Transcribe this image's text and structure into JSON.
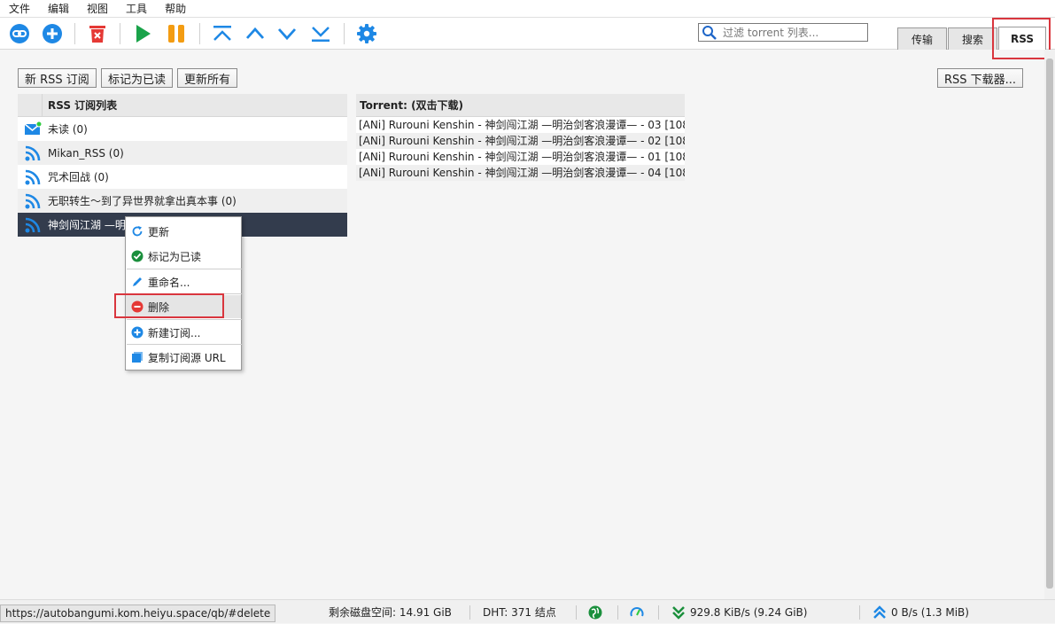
{
  "menu": [
    "文件",
    "编辑",
    "视图",
    "工具",
    "帮助"
  ],
  "search": {
    "placeholder": "过滤 torrent 列表..."
  },
  "tabs": [
    {
      "label": "传输"
    },
    {
      "label": "搜索"
    },
    {
      "label": "RSS"
    }
  ],
  "rss_buttons": {
    "new_feed": "新 RSS 订阅",
    "mark_read": "标记为已读",
    "update_all": "更新所有",
    "downloader": "RSS 下载器..."
  },
  "feeds": {
    "header": "RSS 订阅列表",
    "items": [
      {
        "label": "未读  (0)",
        "icon": "mail-icon"
      },
      {
        "label": "Mikan_RSS (0)",
        "icon": "rss-icon"
      },
      {
        "label": "咒术回战 (0)",
        "icon": "rss-icon"
      },
      {
        "label": "无职转生～到了异世界就拿出真本事 (0)",
        "icon": "rss-icon"
      },
      {
        "label": "神剑闯江湖 —明治剑客浪漫谭— (4)",
        "icon": "rss-icon",
        "selected": true
      }
    ]
  },
  "torrents": {
    "header": "Torrent:   (双击下载)",
    "items": [
      "[ANi] Rurouni Kenshin - 神剑闯江湖 —明治剑客浪漫谭— - 03 [108…",
      "[ANi] Rurouni Kenshin - 神剑闯江湖 —明治剑客浪漫谭— - 02 [108…",
      "[ANi] Rurouni Kenshin - 神剑闯江湖 —明治剑客浪漫谭— - 01 [108…",
      "[ANi] Rurouni Kenshin - 神剑闯江湖 —明治剑客浪漫谭— - 04 [108…"
    ]
  },
  "context_menu": {
    "update": "更新",
    "mark_read": "标记为已读",
    "rename": "重命名...",
    "delete": "删除",
    "new_subscription": "新建订阅...",
    "copy_url": "复制订阅源 URL"
  },
  "status": {
    "url": "https://autobangumi.kom.heiyu.space/qb/#delete",
    "disk": "剩余磁盘空间: 14.91 GiB",
    "dht": "DHT: 371 结点",
    "download": "929.8 KiB/s (9.24 GiB)",
    "upload": "0 B/s (1.3 MiB)"
  },
  "colors": {
    "accent_blue": "#1e88e5",
    "play_green": "#1aa34a",
    "pause_orange": "#f39c12",
    "delete_red": "#e53935",
    "selection": "#333c4d",
    "highlight_red": "#d9363e"
  }
}
